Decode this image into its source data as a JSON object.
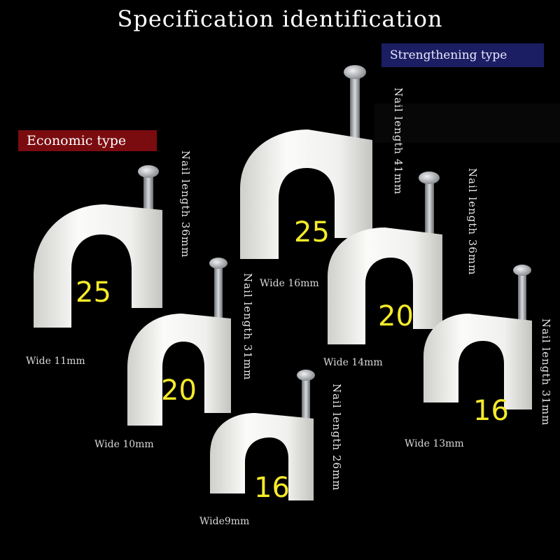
{
  "title": "Specification identification",
  "badges": {
    "economic": "Economic type",
    "strengthening": "Strengthening type"
  },
  "clips": [
    {
      "size": "25",
      "wide": "Wide 11mm",
      "nail": "Nail length 36mm",
      "group": "economic"
    },
    {
      "size": "20",
      "wide": "Wide 10mm",
      "nail": "Nail length 31mm",
      "group": "economic"
    },
    {
      "size": "16",
      "wide": "Wide9mm",
      "nail": "Nail length 26mm",
      "group": "economic"
    },
    {
      "size": "25",
      "wide": "Wide 16mm",
      "nail": "Nail length 41mm",
      "group": "strengthening"
    },
    {
      "size": "20",
      "wide": "Wide 14mm",
      "nail": "Nail length 36mm",
      "group": "strengthening"
    },
    {
      "size": "16",
      "wide": "Wide 13mm",
      "nail": "Nail length 31mm",
      "group": "strengthening"
    }
  ],
  "colors": {
    "background": "#000000",
    "clip": "#f2f2f0",
    "size_label": "#f5ea2a",
    "economic_badge": "#7a0c10",
    "strengthening_badge": "#1c1e63"
  }
}
